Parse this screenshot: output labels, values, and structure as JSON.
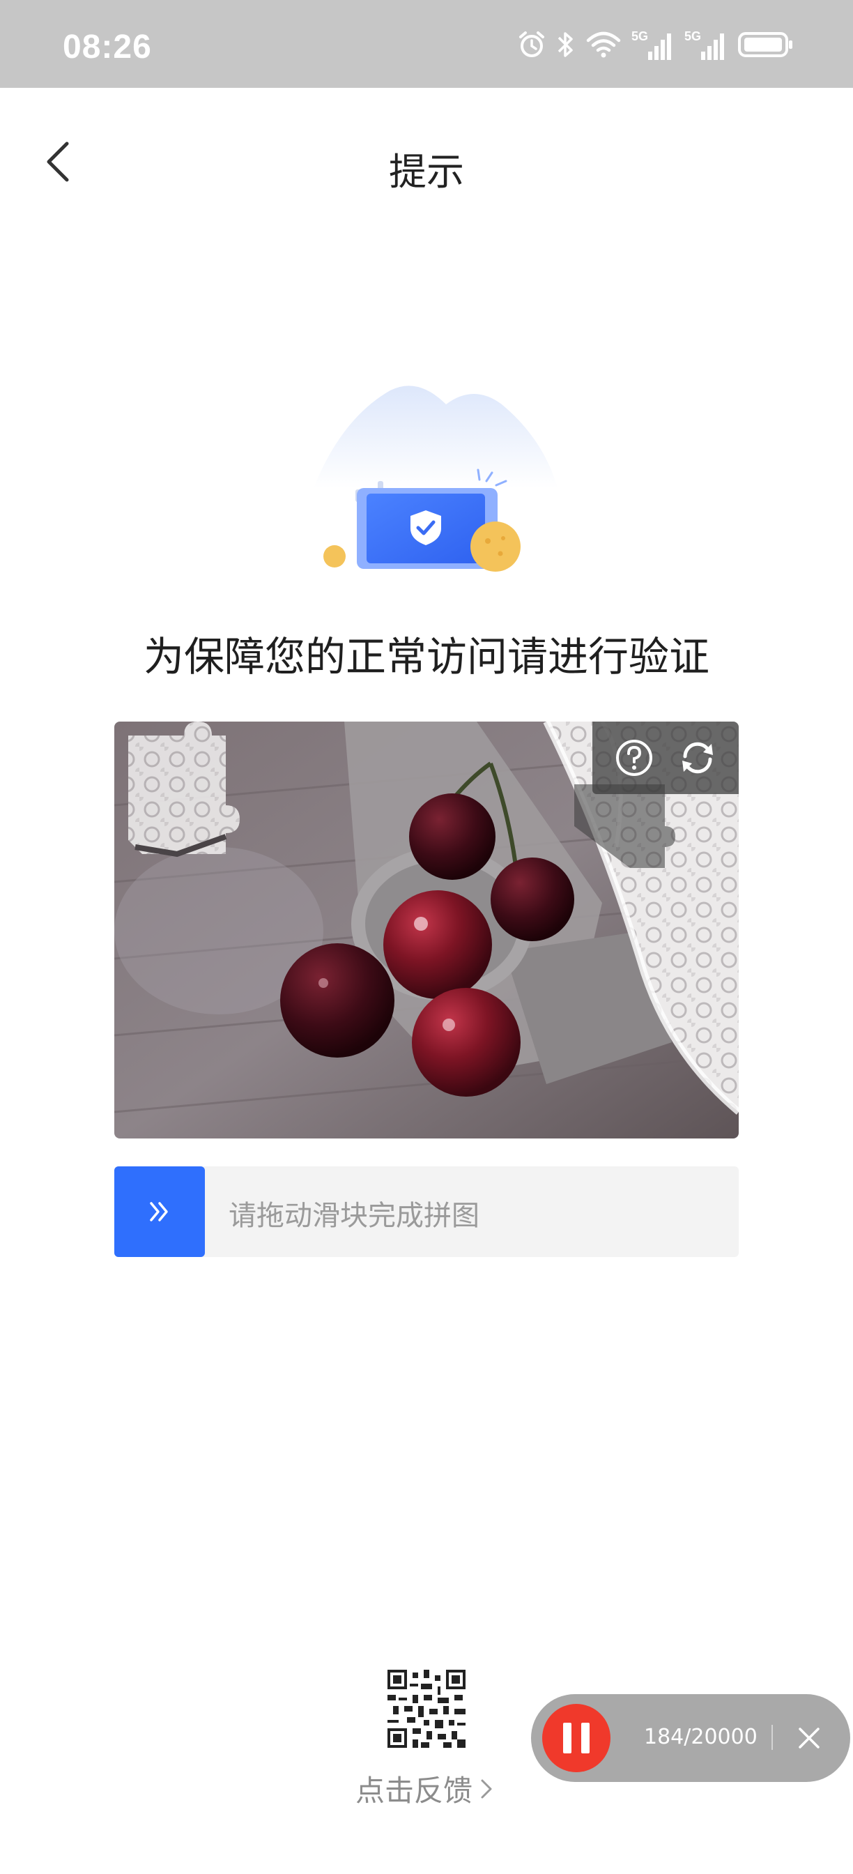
{
  "status_bar": {
    "time": "08:26",
    "icons": [
      "alarm-icon",
      "bluetooth-icon",
      "wifi-icon",
      "signal-5g-icon",
      "signal-5g-icon",
      "battery-icon"
    ],
    "signal_label": "5G"
  },
  "header": {
    "title": "提示",
    "back_icon": "chevron-left-icon"
  },
  "verify": {
    "heading": "为保障您的正常访问请进行验证",
    "illustration": "shield-phone-illustration",
    "tools": [
      "help-icon",
      "refresh-icon"
    ],
    "slider_hint": "请拖动滑块完成拼图",
    "slider_icon": "double-chevron-right-icon",
    "slider_progress": 0
  },
  "feedback": {
    "label": "点击反馈",
    "qr_icon": "qr-code-icon"
  },
  "recorder": {
    "counter": "184/20000"
  },
  "colors": {
    "accent": "#2f6ffd",
    "status_bar": "#c6c6c6",
    "record_red": "#f0392b"
  }
}
